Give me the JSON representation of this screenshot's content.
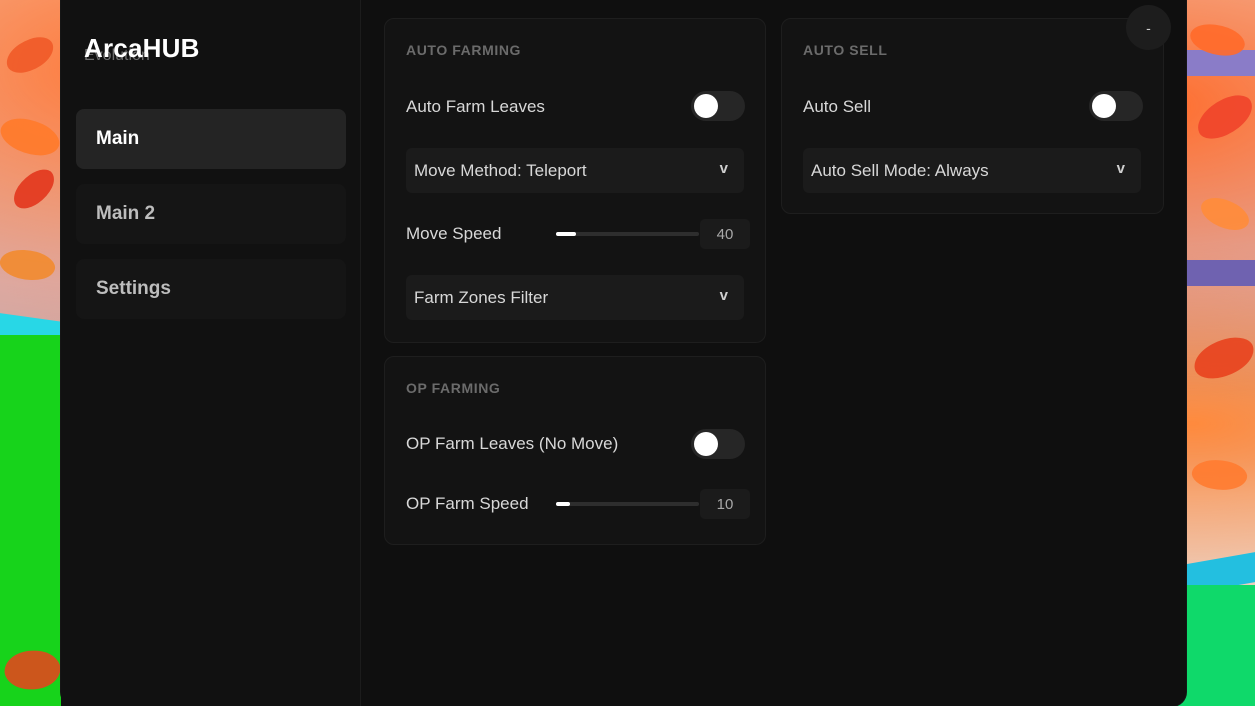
{
  "app": {
    "title": "ArcaHUB",
    "subtitle": "Evolution"
  },
  "sidebar": {
    "items": [
      {
        "label": "Main",
        "active": true
      },
      {
        "label": "Main 2",
        "active": false
      },
      {
        "label": "Settings",
        "active": false
      }
    ]
  },
  "window_controls": {
    "minimize_label": "-"
  },
  "auto_farming": {
    "title": "AUTO FARMING",
    "auto_farm_leaves": {
      "label": "Auto Farm Leaves",
      "enabled": false
    },
    "move_method": {
      "label": "Move Method: Teleport",
      "chevron": "v"
    },
    "move_speed": {
      "label": "Move Speed",
      "value": "40",
      "fill_fraction": 0.14
    },
    "farm_zones_filter": {
      "label": "Farm Zones Filter",
      "chevron": "v"
    }
  },
  "op_farming": {
    "title": "OP FARMING",
    "op_farm_leaves": {
      "label": "OP Farm Leaves (No Move)",
      "enabled": false
    },
    "op_farm_speed": {
      "label": "OP Farm Speed",
      "value": "10",
      "fill_fraction": 0.1
    }
  },
  "auto_sell": {
    "title": "AUTO SELL",
    "auto_sell_toggle": {
      "label": "Auto Sell",
      "enabled": false
    },
    "auto_sell_mode": {
      "label": "Auto Sell Mode: Always",
      "chevron": "v"
    }
  },
  "colors": {
    "window_bg": "#0f0f0f",
    "card_bg": "#131313",
    "active_nav": "#242424",
    "accent": "#ffffff"
  }
}
